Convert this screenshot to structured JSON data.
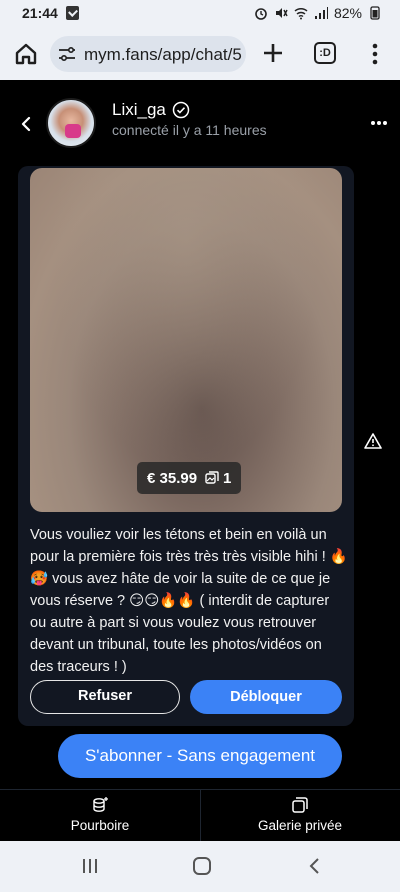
{
  "status_bar": {
    "time": "21:44",
    "battery": "82%"
  },
  "browser": {
    "url": "mym.fans/app/chat/5",
    "tabs_label": ":D"
  },
  "chat_header": {
    "username": "Lixi_ga",
    "presence": "connecté il y a 11 heures"
  },
  "message": {
    "price": "€ 35.99",
    "media_count": "1",
    "text": "Vous vouliez voir les tétons et bein en voilà un pour la première fois très très très visible hihi ! 🔥🥵 vous avez hâte de voir la suite de ce que je vous réserve ? 😏😏🔥🔥 ( interdit de capturer ou autre à part si vous voulez vous retrouver devant un tribunal, toute les photos/vidéos on des traceurs ! )",
    "refuse_label": "Refuser",
    "unlock_label": "Débloquer"
  },
  "cta": {
    "subscribe_label": "S'abonner - Sans engagement"
  },
  "bottom_actions": {
    "tip_label": "Pourboire",
    "gallery_label": "Galerie privée"
  },
  "colors": {
    "accent": "#3b82f6",
    "card_bg": "#121722",
    "chrome_bg": "#eef1f6"
  }
}
